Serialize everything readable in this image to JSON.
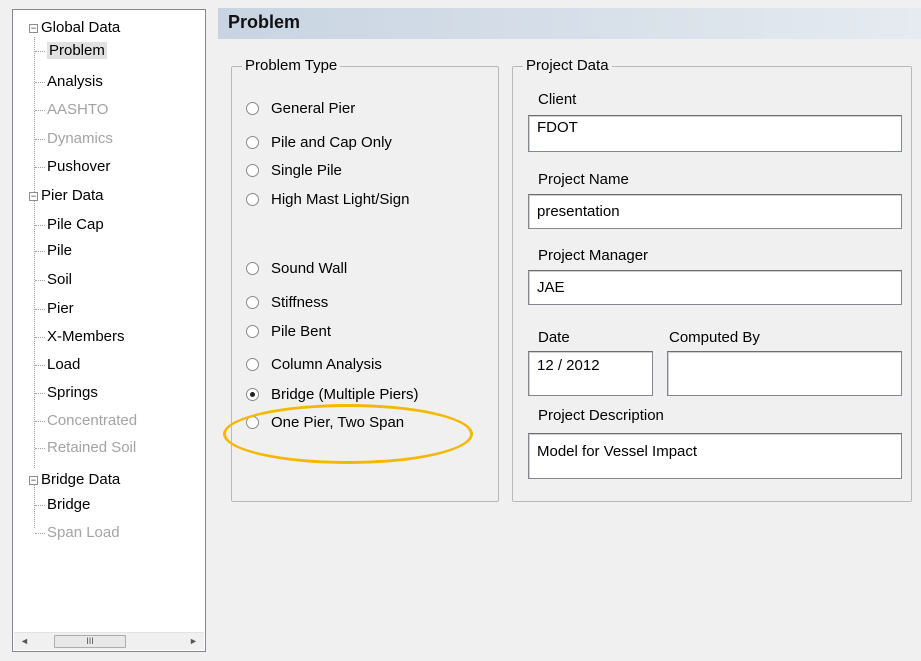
{
  "tree": {
    "nodes": [
      {
        "label": "Global Data",
        "toggle": "−",
        "disabled": false
      },
      {
        "label": "Problem",
        "disabled": false,
        "selected": true
      },
      {
        "label": "Analysis",
        "disabled": false
      },
      {
        "label": "AASHTO",
        "disabled": true
      },
      {
        "label": "Dynamics",
        "disabled": true
      },
      {
        "label": "Pushover",
        "disabled": false
      },
      {
        "label": "Pier Data",
        "toggle": "−",
        "disabled": false
      },
      {
        "label": "Pile Cap",
        "disabled": false
      },
      {
        "label": "Pile",
        "disabled": false
      },
      {
        "label": "Soil",
        "disabled": false
      },
      {
        "label": "Pier",
        "disabled": false
      },
      {
        "label": "X-Members",
        "disabled": false
      },
      {
        "label": "Load",
        "disabled": false
      },
      {
        "label": "Springs",
        "disabled": false
      },
      {
        "label": "Concentrated",
        "disabled": true
      },
      {
        "label": "Retained Soil",
        "disabled": true
      },
      {
        "label": "Bridge Data",
        "toggle": "−",
        "disabled": false
      },
      {
        "label": "Bridge",
        "disabled": false
      },
      {
        "label": "Span Load",
        "disabled": true
      }
    ],
    "scroll_left_icon": "◄",
    "scroll_thumb_grip": "III",
    "scroll_right_icon": "►"
  },
  "header": {
    "title": "Problem"
  },
  "problem_type": {
    "legend": "Problem Type",
    "options": [
      {
        "label": "General Pier",
        "checked": false
      },
      {
        "label": "Pile and Cap Only",
        "checked": false
      },
      {
        "label": "Single Pile",
        "checked": false
      },
      {
        "label": "High Mast Light/Sign",
        "checked": false
      },
      {
        "label": "Sound Wall",
        "checked": false
      },
      {
        "label": "Stiffness",
        "checked": false
      },
      {
        "label": "Pile Bent",
        "checked": false
      },
      {
        "label": "Column Analysis",
        "checked": false
      },
      {
        "label": "Bridge (Multiple Piers)",
        "checked": true
      },
      {
        "label": "One Pier, Two Span",
        "checked": false
      }
    ]
  },
  "project_data": {
    "legend": "Project Data",
    "client_label": "Client",
    "client_value": "FDOT",
    "project_name_label": "Project Name",
    "project_name_value": "presentation",
    "project_manager_label": "Project Manager",
    "project_manager_value": "JAE",
    "date_label": "Date",
    "date_value": "12 / 2012",
    "computed_by_label": "Computed By",
    "computed_by_value": "",
    "description_label": "Project Description",
    "description_value": "Model for Vessel Impact"
  },
  "colors": {
    "highlight": "#f4b800",
    "header_bg": "#c8d4e2"
  }
}
